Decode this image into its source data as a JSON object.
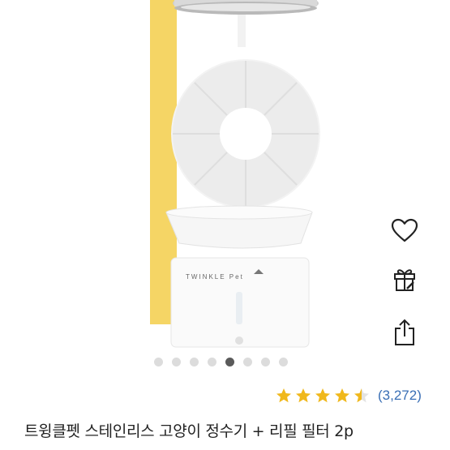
{
  "product": {
    "title": "트윙클펫 스테인리스 고양이 정수기 + 리필 필터 2p",
    "brand_on_image": "TWINKLE Pet",
    "rating": 4.5,
    "rating_count": "(3,272)"
  },
  "gallery": {
    "dot_count": 8,
    "active_index": 4
  },
  "actions": [
    {
      "name": "wishlist",
      "icon": "heart-icon"
    },
    {
      "name": "gift",
      "icon": "gift-icon"
    },
    {
      "name": "share",
      "icon": "share-icon"
    }
  ],
  "colors": {
    "accent_yellow": "#f5d565",
    "star": "#f0b81c",
    "link_blue": "#3a6fb5",
    "dot_active": "#5a5a5a",
    "dot_inactive": "#dcdcdc"
  }
}
